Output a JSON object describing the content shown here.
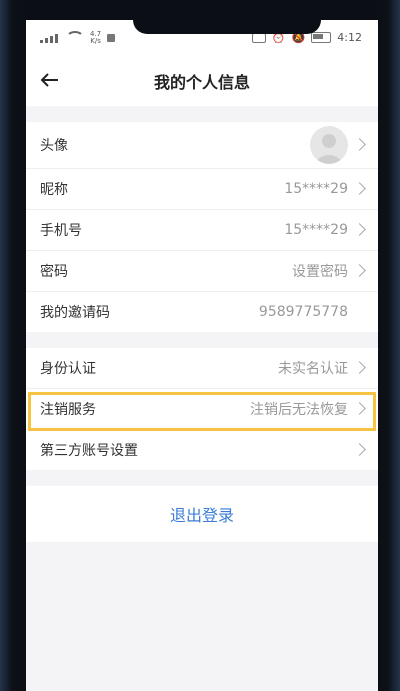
{
  "status_bar": {
    "speed_top": "4.7",
    "speed_bottom": "K/s",
    "time": "4:12"
  },
  "header": {
    "title": "我的个人信息"
  },
  "profile_rows": [
    {
      "label": "头像",
      "value": ""
    },
    {
      "label": "昵称",
      "value": "15****29"
    },
    {
      "label": "手机号",
      "value": "15****29"
    },
    {
      "label": "密码",
      "value": "设置密码"
    },
    {
      "label": "我的邀请码",
      "value": "9589775778"
    }
  ],
  "account_rows": [
    {
      "label": "身份认证",
      "value": "未实名认证"
    },
    {
      "label": "注销服务",
      "value": "注销后无法恢复"
    },
    {
      "label": "第三方账号设置",
      "value": ""
    }
  ],
  "logout_label": "退出登录",
  "colors": {
    "link_blue": "#3b7dd8",
    "highlight_yellow": "#f6c443"
  }
}
